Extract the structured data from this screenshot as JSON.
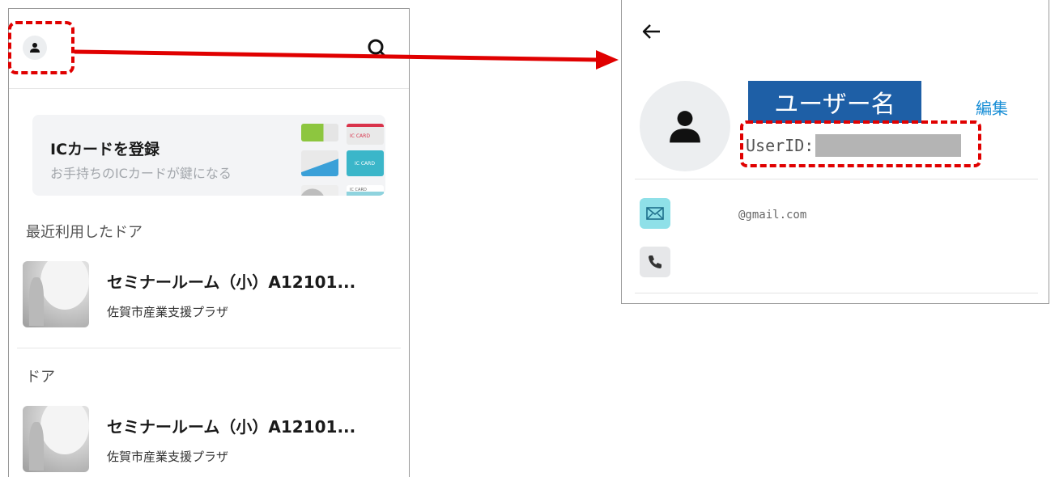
{
  "left": {
    "ic_card": {
      "title": "ICカードを登録",
      "subtitle": "お手持ちのICカードが鍵になる",
      "card_labels": [
        "IC CARD",
        "IC CARD",
        "IC CARD"
      ]
    },
    "recent_section_label": "最近利用したドア",
    "doors_section_label": "ドア",
    "recent_doors": [
      {
        "name": "セミナールーム（小）A12101...",
        "place": "佐賀市産業支援プラザ"
      }
    ],
    "doors": [
      {
        "name": "セミナールーム（小）A12101...",
        "place": "佐賀市産業支援プラザ"
      }
    ]
  },
  "right": {
    "username": "ユーザー名",
    "edit_label": "編集",
    "userid_label": "UserID:",
    "email": "@gmail.com"
  },
  "colors": {
    "highlight": "#e00000",
    "username_bg": "#1e5fa6",
    "edit_link": "#1a8fd6",
    "email_icon_bg": "#8fe0e8",
    "phone_icon_bg": "#e6e7e9"
  },
  "icons": [
    "person-icon",
    "search-icon",
    "arrow-left-icon",
    "mail-icon",
    "phone-icon"
  ]
}
